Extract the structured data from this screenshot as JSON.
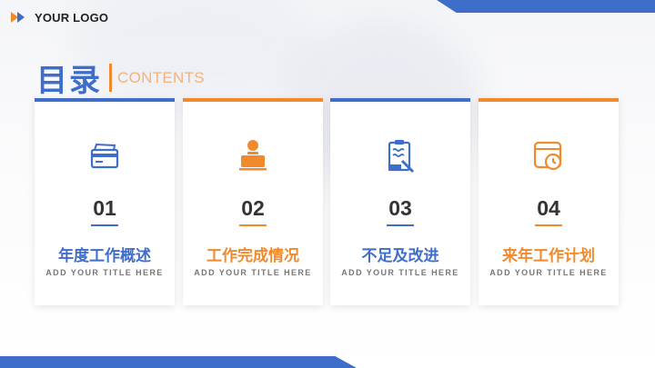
{
  "logo": {
    "text": "YOUR LOGO"
  },
  "title": {
    "main": "目录",
    "sub": "CONTENTS"
  },
  "colors": {
    "blue": "#3f6dca",
    "orange": "#f08a2c"
  },
  "cards": [
    {
      "number": "01",
      "label": "年度工作概述",
      "subtitle": "ADD YOUR TITLE HERE",
      "accent": "blue",
      "icon": "credit-card-icon"
    },
    {
      "number": "02",
      "label": "工作完成情况",
      "subtitle": "ADD YOUR TITLE HERE",
      "accent": "orange",
      "icon": "user-at-desk-icon"
    },
    {
      "number": "03",
      "label": "不足及改进",
      "subtitle": "ADD YOUR TITLE HERE",
      "accent": "blue",
      "icon": "clipboard-edit-icon"
    },
    {
      "number": "04",
      "label": "来年工作计划",
      "subtitle": "ADD YOUR TITLE HERE",
      "accent": "orange",
      "icon": "calendar-clock-icon"
    }
  ]
}
